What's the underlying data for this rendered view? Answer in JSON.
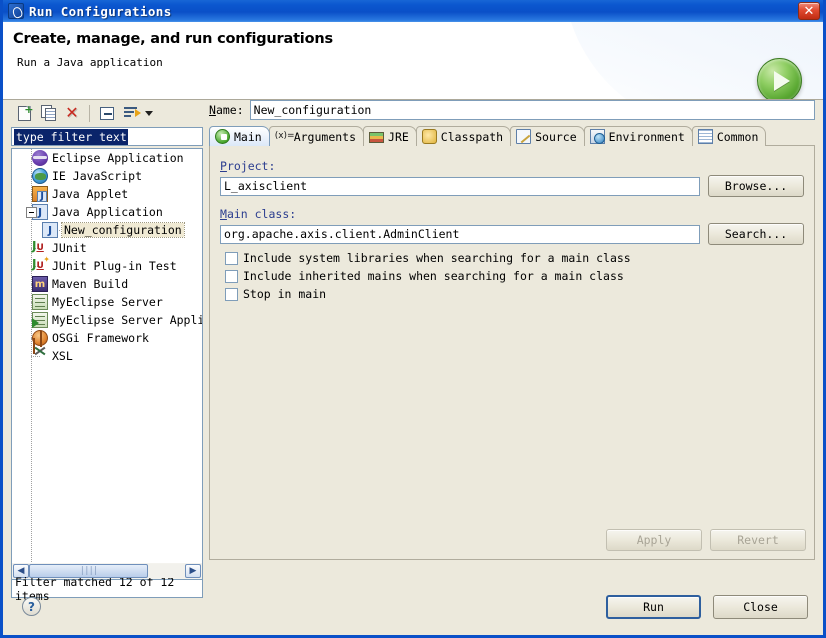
{
  "window": {
    "title": "Run Configurations",
    "icon": "run-configurations-icon",
    "close_label": "✕"
  },
  "header": {
    "title": "Create, manage, and run configurations",
    "subtitle": "Run a Java application",
    "badge_icon": "green-run-arrow-icon"
  },
  "toolbar": {
    "buttons": [
      {
        "name": "new-launch-configuration-button",
        "icon": "new-page-icon"
      },
      {
        "name": "duplicate-launch-configuration-button",
        "icon": "copy-icon"
      },
      {
        "name": "delete-launch-configuration-button",
        "icon": "delete-red-x-icon"
      },
      {
        "name": "collapse-all-button",
        "icon": "collapse-all-icon"
      },
      {
        "name": "filter-button",
        "icon": "filter-icon"
      }
    ]
  },
  "filter": {
    "value": "type filter text",
    "placeholder": "type filter text"
  },
  "tree": {
    "items": [
      {
        "label": "Eclipse Application",
        "icon": "eclipse",
        "level": 0,
        "expander": false,
        "selected": false
      },
      {
        "label": "IE JavaScript",
        "icon": "globe",
        "level": 0,
        "expander": false,
        "selected": false
      },
      {
        "label": "Java Applet",
        "icon": "japplet",
        "level": 0,
        "expander": false,
        "selected": false
      },
      {
        "label": "Java Application",
        "icon": "japp",
        "level": 0,
        "expander": true,
        "selected": false
      },
      {
        "label": "New_configuration",
        "icon": "japp",
        "level": 1,
        "expander": false,
        "selected": true
      },
      {
        "label": "JUnit",
        "icon": "junit",
        "level": 0,
        "expander": false,
        "selected": false
      },
      {
        "label": "JUnit Plug-in Test",
        "icon": "junitplug",
        "level": 0,
        "expander": false,
        "selected": false
      },
      {
        "label": "Maven Build",
        "icon": "maven",
        "level": 0,
        "expander": false,
        "selected": false
      },
      {
        "label": "MyEclipse Server",
        "icon": "server",
        "level": 0,
        "expander": false,
        "selected": false
      },
      {
        "label": "MyEclipse Server Applic",
        "icon": "serverapp",
        "level": 0,
        "expander": false,
        "selected": false
      },
      {
        "label": "OSGi Framework",
        "icon": "osgi",
        "level": 0,
        "expander": false,
        "selected": false
      },
      {
        "label": "XSL",
        "icon": "xsl",
        "level": 0,
        "expander": false,
        "selected": false
      }
    ]
  },
  "scrollbar": {
    "left_arrow": "◀",
    "right_arrow": "▶",
    "thumb_grip": "||||"
  },
  "status": {
    "filter_match": "Filter matched 12 of 12 items"
  },
  "name_field": {
    "label": "Name:",
    "label_mnemonic": "N",
    "value": "New_configuration"
  },
  "tabs": [
    {
      "label": "Main",
      "icon": "main-icon",
      "active": true
    },
    {
      "label": "Arguments",
      "icon": "arguments-icon",
      "active": false
    },
    {
      "label": "JRE",
      "icon": "jre-icon",
      "active": false
    },
    {
      "label": "Classpath",
      "icon": "classpath-icon",
      "active": false
    },
    {
      "label": "Source",
      "icon": "source-icon",
      "active": false
    },
    {
      "label": "Environment",
      "icon": "environment-icon",
      "active": false
    },
    {
      "label": "Common",
      "icon": "common-icon",
      "active": false
    }
  ],
  "main_tab": {
    "project": {
      "label": "Project:",
      "value": "L_axisclient",
      "button": "Browse..."
    },
    "main_class": {
      "label": "Main class:",
      "value": "org.apache.axis.client.AdminClient",
      "button": "Search..."
    },
    "checkboxes": [
      {
        "label": "Include system libraries when searching for a main class",
        "checked": false
      },
      {
        "label": "Include inherited mains when searching for a main class",
        "checked": false
      },
      {
        "label": "Stop in main",
        "checked": false
      }
    ]
  },
  "action_buttons": {
    "apply": "Apply",
    "revert": "Revert",
    "apply_enabled": false,
    "revert_enabled": false
  },
  "footer": {
    "help": "?",
    "run": "Run",
    "close": "Close"
  },
  "colors": {
    "titlebar": "#0a50c8",
    "panel": "#ece9dc",
    "field": "#ffffff",
    "selection": "#0a246a",
    "group_label": "#2b3d8f",
    "accent_green": "#4aa82e",
    "close_red": "#c02c12"
  }
}
